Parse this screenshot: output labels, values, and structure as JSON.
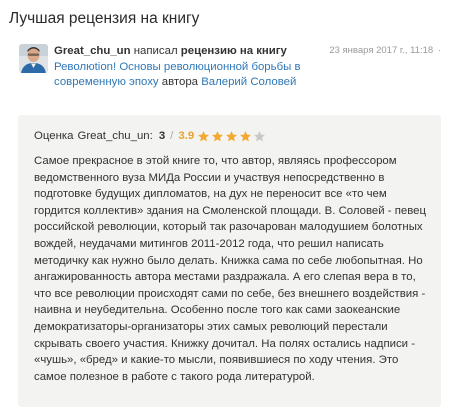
{
  "section_title": "Лучшая рецензия на книгу",
  "header": {
    "username": "Great_chu_un",
    "wrote": "написал",
    "review_link": "рецензию на книгу",
    "book_title": "Революtion! Основы революционной борьбы в современную эпоху",
    "author_word": "автора",
    "author_name": "Валерий Соловей",
    "timestamp": "23 января 2017 г., 11:18",
    "timestamp_sep": "·"
  },
  "review": {
    "rating_label": "Оценка",
    "rating_user": "Great_chu_un:",
    "rating_value": "3",
    "separator": "/",
    "average": "3.9",
    "stars": [
      1,
      1,
      1,
      1,
      0
    ],
    "star_colors": {
      "filled": "#f3a831",
      "empty": "#c8c8c8"
    },
    "body": "Самое прекрасное в этой книге то, что автор, являясь профессором ведомственного вуза МИДа России и участвуя непосредственно в подготовке будущих дипломатов, на дух не переносит все «то чем гордится коллектив» здания на Смоленской площади. В. Соловей - певец российской революции, который так разочарован малодушием болотных вождей, неудачами митингов 2011-2012 года, что решил написать методичку как нужно было делать. Книжка сама по себе любопытная. Но ангажированность автора местами раздражала. А его слепая вера в то, что все революции происходят сами по себе, без внешнего воздействия - наивна и неубедительна. Особенно после того как сами заокеанские демократизаторы-организаторы этих самых революций перестали скрывать своего участия. Книжку дочитал. На полях остались надписи - «чушь», «бред» и какие-то мысли, появившиеся по ходу чтения. Это самое полезное в работе с такого рода литературой."
  },
  "colors": {
    "link": "#2f78b7",
    "box_background": "#f3f3f1",
    "accent": "#e8a32d"
  }
}
